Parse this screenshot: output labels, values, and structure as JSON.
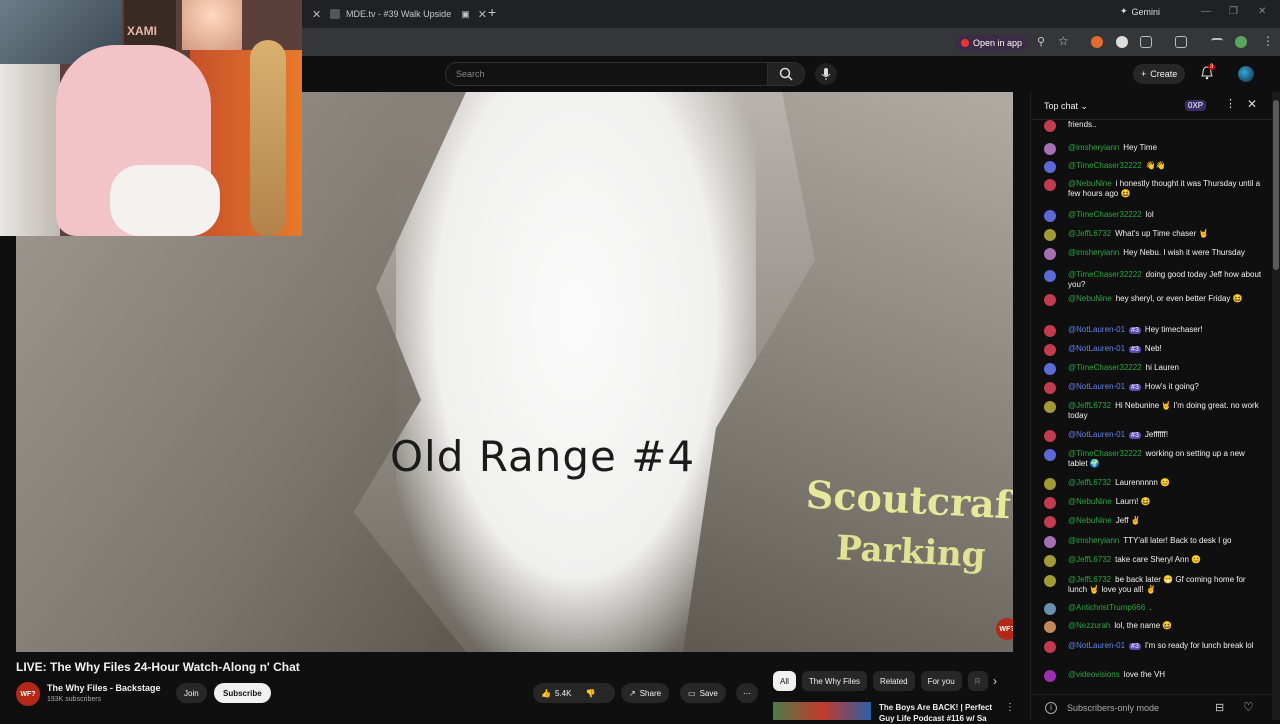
{
  "browser": {
    "tabs": [
      {
        "label": "MDE.tv - #39 Walk Upside"
      }
    ],
    "gemini_label": "Gemini",
    "open_in_app": "Open in app"
  },
  "youtube": {
    "search_placeholder": "Search",
    "create_label": "Create",
    "notifications_count": "3"
  },
  "video": {
    "overlay_title": "Old Range #4",
    "overlay_text_1": "Scoutcraf",
    "overlay_text_2": "Parking",
    "logo": "WF?",
    "cam_text": "XAMI",
    "title": "LIVE: The Why Files 24-Hour Watch-Along n' Chat"
  },
  "channel": {
    "name": "The Why Files - Backstage",
    "subscribers": "193K subscribers",
    "avatar_text": "WF?",
    "join_label": "Join",
    "subscribe_label": "Subscribe"
  },
  "actions": {
    "likes": "5.4K",
    "share": "Share",
    "save": "Save"
  },
  "chips": [
    "All",
    "The Why Files",
    "Related",
    "For you",
    "R"
  ],
  "recommendation": {
    "title": "The Boys Are BACK! | Perfect Guy Life Podcast #116 w/ Sa"
  },
  "chat": {
    "title": "Top chat",
    "xp": "0XP",
    "footer_label": "Subscribers-only mode",
    "messages": [
      {
        "author": "",
        "text": "friends..",
        "type": "member",
        "color": "#c23b4f"
      },
      {
        "author": "@imsheryiann",
        "text": "Hey Time",
        "type": "normal",
        "color": "#a46fb3"
      },
      {
        "author": "@TimeChaser32222",
        "text": "👋👋",
        "type": "normal",
        "color": "#5b6ad6"
      },
      {
        "author": "@NebuNine",
        "text": "i honestly thought it was Thursday until a few hours ago 😆",
        "type": "normal",
        "color": "#c23b4f"
      },
      {
        "author": "@TimeChaser32222",
        "text": "lol",
        "type": "normal",
        "color": "#5b6ad6"
      },
      {
        "author": "@JeffL6732",
        "text": "What's up Time chaser 🤘",
        "type": "normal",
        "color": "#a29a35"
      },
      {
        "author": "@imsheryiann",
        "text": "Hey Nebu. I wish it were Thursday",
        "type": "normal",
        "color": "#a46fb3"
      },
      {
        "author": "@TimeChaser32222",
        "text": "doing good today Jeff how about you?",
        "type": "normal",
        "color": "#5b6ad6"
      },
      {
        "author": "@NebuNine",
        "text": "hey sheryl, or even better Friday 😆",
        "type": "normal",
        "color": "#c23b4f"
      },
      {
        "author": "@NotLauren-01",
        "text": "Hey timechaser!",
        "type": "mod",
        "rank": "#3",
        "color": "#c23b4f"
      },
      {
        "author": "@NotLauren-01",
        "text": "Neb!",
        "type": "mod",
        "rank": "#3",
        "color": "#c23b4f"
      },
      {
        "author": "@TimeChaser32222",
        "text": "hi Lauren",
        "type": "normal",
        "color": "#5b6ad6"
      },
      {
        "author": "@NotLauren-01",
        "text": "How's it going?",
        "type": "mod",
        "rank": "#3",
        "color": "#c23b4f"
      },
      {
        "author": "@JeffL6732",
        "text": "Hi Nebunine 🤘 I'm doing great. no work today",
        "type": "normal",
        "color": "#a29a35"
      },
      {
        "author": "@NotLauren-01",
        "text": "Jeffffff!",
        "type": "mod",
        "rank": "#3",
        "color": "#c23b4f"
      },
      {
        "author": "@TimeChaser32222",
        "text": "working on setting up a new tablet 🌍",
        "type": "normal",
        "color": "#5b6ad6"
      },
      {
        "author": "@JeffL6732",
        "text": "Laurennnnn 😊",
        "type": "normal",
        "color": "#a29a35"
      },
      {
        "author": "@NebuNine",
        "text": "Laurn! 😆",
        "type": "normal",
        "color": "#c23b4f"
      },
      {
        "author": "@NebuNine",
        "text": "Jeff ✌",
        "type": "normal",
        "color": "#c23b4f"
      },
      {
        "author": "@imsheryiann",
        "text": "TTY'all later! Back to desk I go",
        "type": "normal",
        "color": "#a46fb3"
      },
      {
        "author": "@JeffL6732",
        "text": "take care Sheryl Ann 😊",
        "type": "normal",
        "color": "#a29a35"
      },
      {
        "author": "@JeffL6732",
        "text": "be back later 😁 Gf coming home for lunch 🤘 love you all! ✌",
        "type": "normal",
        "color": "#a29a35"
      },
      {
        "author": "@AntichristTrump666",
        "text": ".",
        "type": "normal",
        "color": "#6a8fb0"
      },
      {
        "author": "@Nezzurah",
        "text": "lol, the name 😆",
        "type": "normal",
        "color": "#c28a5a"
      },
      {
        "author": "@NotLauren-01",
        "text": "I'm so ready for lunch break lol",
        "type": "mod",
        "rank": "#3",
        "color": "#c23b4f"
      },
      {
        "author": "@videovisions",
        "text": "love the VH",
        "type": "normal",
        "color": "#9c2fb0"
      }
    ]
  }
}
